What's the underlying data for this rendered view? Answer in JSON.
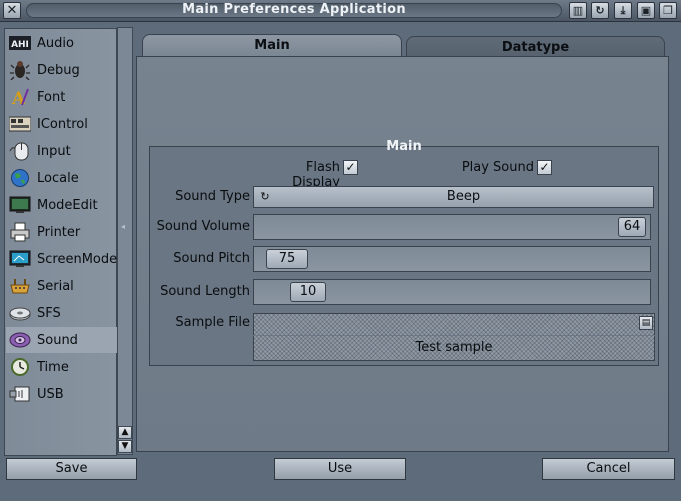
{
  "window": {
    "title": "Main Preferences Application",
    "close_icon": "close-icon",
    "title_buttons": [
      "iconify-icon",
      "snapshot-icon",
      "minimize-icon",
      "zoom-icon",
      "depth-icon"
    ]
  },
  "sidebar": {
    "items": [
      {
        "label": "Audio",
        "icon": "ahi-icon"
      },
      {
        "label": "Debug",
        "icon": "bug-icon"
      },
      {
        "label": "Font",
        "icon": "font-icon"
      },
      {
        "label": "IControl",
        "icon": "icontrol-icon"
      },
      {
        "label": "Input",
        "icon": "mouse-icon"
      },
      {
        "label": "Locale",
        "icon": "globe-icon"
      },
      {
        "label": "ModeEdit",
        "icon": "monitor-icon"
      },
      {
        "label": "Printer",
        "icon": "printer-icon"
      },
      {
        "label": "ScreenMode",
        "icon": "screen-icon"
      },
      {
        "label": "Serial",
        "icon": "serial-icon"
      },
      {
        "label": "SFS",
        "icon": "disk-icon"
      },
      {
        "label": "Sound",
        "icon": "speaker-icon"
      },
      {
        "label": "Time",
        "icon": "clock-icon"
      },
      {
        "label": "USB",
        "icon": "usb-icon"
      }
    ],
    "selected": "Sound"
  },
  "tabs": {
    "main": "Main",
    "datatype": "Datatype"
  },
  "group": {
    "title": "Main",
    "flash_display_label": "Flash Display",
    "flash_display_checked": true,
    "play_sound_label": "Play Sound",
    "play_sound_checked": true,
    "sound_type_label": "Sound Type",
    "sound_type_value": "Beep",
    "sound_volume_label": "Sound Volume",
    "sound_volume_value": "64",
    "sound_pitch_label": "Sound Pitch",
    "sound_pitch_value": "75",
    "sound_length_label": "Sound Length",
    "sound_length_value": "10",
    "sample_file_label": "Sample File",
    "sample_file_value": "",
    "test_sample_label": "Test sample"
  },
  "buttons": {
    "save": "Save",
    "use": "Use",
    "cancel": "Cancel"
  },
  "colors": {
    "window_bg": "#5d6b7b",
    "panel_bg": "#77838f",
    "selected_item": "#9aa5b1"
  }
}
